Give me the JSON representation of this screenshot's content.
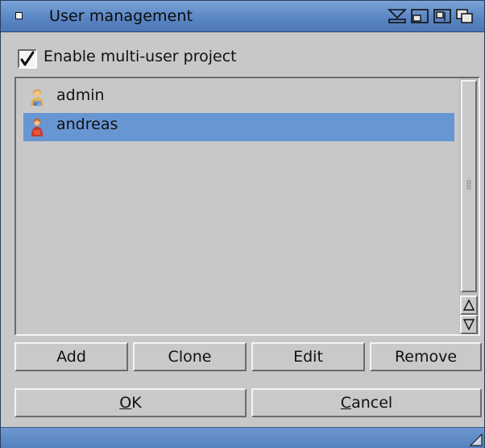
{
  "window": {
    "title": "User management"
  },
  "options": {
    "multi_user_label": "Enable multi-user project",
    "multi_user_checked": true
  },
  "users": [
    {
      "name": "admin",
      "icon": "admin-user-icon",
      "selected": false
    },
    {
      "name": "andreas",
      "icon": "user-icon",
      "selected": true
    }
  ],
  "list_buttons": {
    "add": "Add",
    "clone": "Clone",
    "edit": "Edit",
    "remove": "Remove"
  },
  "dialog_buttons": {
    "ok_accel": "O",
    "ok_rest": "K",
    "cancel_accel": "C",
    "cancel_rest": "ancel"
  },
  "colors": {
    "titlebar": "#5b86c4",
    "selection": "#6896d3",
    "background": "#c8c8c8"
  }
}
